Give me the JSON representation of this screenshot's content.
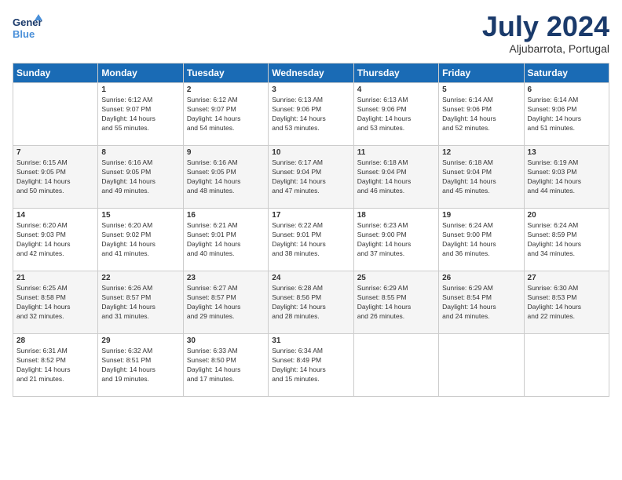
{
  "logo": {
    "line1": "General",
    "line2": "Blue"
  },
  "title": "July 2024",
  "subtitle": "Aljubarrota, Portugal",
  "headers": [
    "Sunday",
    "Monday",
    "Tuesday",
    "Wednesday",
    "Thursday",
    "Friday",
    "Saturday"
  ],
  "weeks": [
    [
      {
        "day": "",
        "info": ""
      },
      {
        "day": "1",
        "info": "Sunrise: 6:12 AM\nSunset: 9:07 PM\nDaylight: 14 hours\nand 55 minutes."
      },
      {
        "day": "2",
        "info": "Sunrise: 6:12 AM\nSunset: 9:07 PM\nDaylight: 14 hours\nand 54 minutes."
      },
      {
        "day": "3",
        "info": "Sunrise: 6:13 AM\nSunset: 9:06 PM\nDaylight: 14 hours\nand 53 minutes."
      },
      {
        "day": "4",
        "info": "Sunrise: 6:13 AM\nSunset: 9:06 PM\nDaylight: 14 hours\nand 53 minutes."
      },
      {
        "day": "5",
        "info": "Sunrise: 6:14 AM\nSunset: 9:06 PM\nDaylight: 14 hours\nand 52 minutes."
      },
      {
        "day": "6",
        "info": "Sunrise: 6:14 AM\nSunset: 9:06 PM\nDaylight: 14 hours\nand 51 minutes."
      }
    ],
    [
      {
        "day": "7",
        "info": "Sunrise: 6:15 AM\nSunset: 9:05 PM\nDaylight: 14 hours\nand 50 minutes."
      },
      {
        "day": "8",
        "info": "Sunrise: 6:16 AM\nSunset: 9:05 PM\nDaylight: 14 hours\nand 49 minutes."
      },
      {
        "day": "9",
        "info": "Sunrise: 6:16 AM\nSunset: 9:05 PM\nDaylight: 14 hours\nand 48 minutes."
      },
      {
        "day": "10",
        "info": "Sunrise: 6:17 AM\nSunset: 9:04 PM\nDaylight: 14 hours\nand 47 minutes."
      },
      {
        "day": "11",
        "info": "Sunrise: 6:18 AM\nSunset: 9:04 PM\nDaylight: 14 hours\nand 46 minutes."
      },
      {
        "day": "12",
        "info": "Sunrise: 6:18 AM\nSunset: 9:04 PM\nDaylight: 14 hours\nand 45 minutes."
      },
      {
        "day": "13",
        "info": "Sunrise: 6:19 AM\nSunset: 9:03 PM\nDaylight: 14 hours\nand 44 minutes."
      }
    ],
    [
      {
        "day": "14",
        "info": "Sunrise: 6:20 AM\nSunset: 9:03 PM\nDaylight: 14 hours\nand 42 minutes."
      },
      {
        "day": "15",
        "info": "Sunrise: 6:20 AM\nSunset: 9:02 PM\nDaylight: 14 hours\nand 41 minutes."
      },
      {
        "day": "16",
        "info": "Sunrise: 6:21 AM\nSunset: 9:01 PM\nDaylight: 14 hours\nand 40 minutes."
      },
      {
        "day": "17",
        "info": "Sunrise: 6:22 AM\nSunset: 9:01 PM\nDaylight: 14 hours\nand 38 minutes."
      },
      {
        "day": "18",
        "info": "Sunrise: 6:23 AM\nSunset: 9:00 PM\nDaylight: 14 hours\nand 37 minutes."
      },
      {
        "day": "19",
        "info": "Sunrise: 6:24 AM\nSunset: 9:00 PM\nDaylight: 14 hours\nand 36 minutes."
      },
      {
        "day": "20",
        "info": "Sunrise: 6:24 AM\nSunset: 8:59 PM\nDaylight: 14 hours\nand 34 minutes."
      }
    ],
    [
      {
        "day": "21",
        "info": "Sunrise: 6:25 AM\nSunset: 8:58 PM\nDaylight: 14 hours\nand 32 minutes."
      },
      {
        "day": "22",
        "info": "Sunrise: 6:26 AM\nSunset: 8:57 PM\nDaylight: 14 hours\nand 31 minutes."
      },
      {
        "day": "23",
        "info": "Sunrise: 6:27 AM\nSunset: 8:57 PM\nDaylight: 14 hours\nand 29 minutes."
      },
      {
        "day": "24",
        "info": "Sunrise: 6:28 AM\nSunset: 8:56 PM\nDaylight: 14 hours\nand 28 minutes."
      },
      {
        "day": "25",
        "info": "Sunrise: 6:29 AM\nSunset: 8:55 PM\nDaylight: 14 hours\nand 26 minutes."
      },
      {
        "day": "26",
        "info": "Sunrise: 6:29 AM\nSunset: 8:54 PM\nDaylight: 14 hours\nand 24 minutes."
      },
      {
        "day": "27",
        "info": "Sunrise: 6:30 AM\nSunset: 8:53 PM\nDaylight: 14 hours\nand 22 minutes."
      }
    ],
    [
      {
        "day": "28",
        "info": "Sunrise: 6:31 AM\nSunset: 8:52 PM\nDaylight: 14 hours\nand 21 minutes."
      },
      {
        "day": "29",
        "info": "Sunrise: 6:32 AM\nSunset: 8:51 PM\nDaylight: 14 hours\nand 19 minutes."
      },
      {
        "day": "30",
        "info": "Sunrise: 6:33 AM\nSunset: 8:50 PM\nDaylight: 14 hours\nand 17 minutes."
      },
      {
        "day": "31",
        "info": "Sunrise: 6:34 AM\nSunset: 8:49 PM\nDaylight: 14 hours\nand 15 minutes."
      },
      {
        "day": "",
        "info": ""
      },
      {
        "day": "",
        "info": ""
      },
      {
        "day": "",
        "info": ""
      }
    ]
  ]
}
